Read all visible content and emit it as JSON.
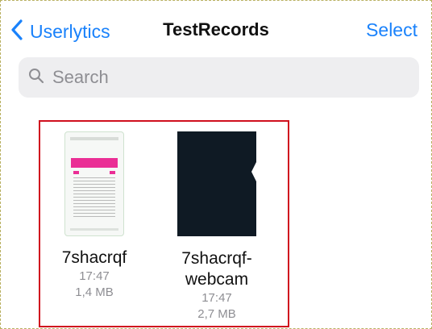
{
  "nav": {
    "back_label": "Userlytics",
    "title": "TestRecords",
    "select_label": "Select"
  },
  "search": {
    "placeholder": "Search",
    "value": ""
  },
  "files": [
    {
      "name": "7shacrqf",
      "time": "17:47",
      "size": "1,4 MB",
      "thumbnail": "document-preview"
    },
    {
      "name_line1": "7shacrqf-",
      "name_line2": "webcam",
      "time": "17:47",
      "size": "2,7 MB",
      "thumbnail": "video-preview"
    }
  ],
  "colors": {
    "accent": "#1a82fb",
    "highlight_border": "#d0101e",
    "doc_accent": "#ea2e95",
    "video_thumb": "#0f1a24"
  },
  "icons": [
    "chevron-left-icon",
    "search-icon"
  ]
}
